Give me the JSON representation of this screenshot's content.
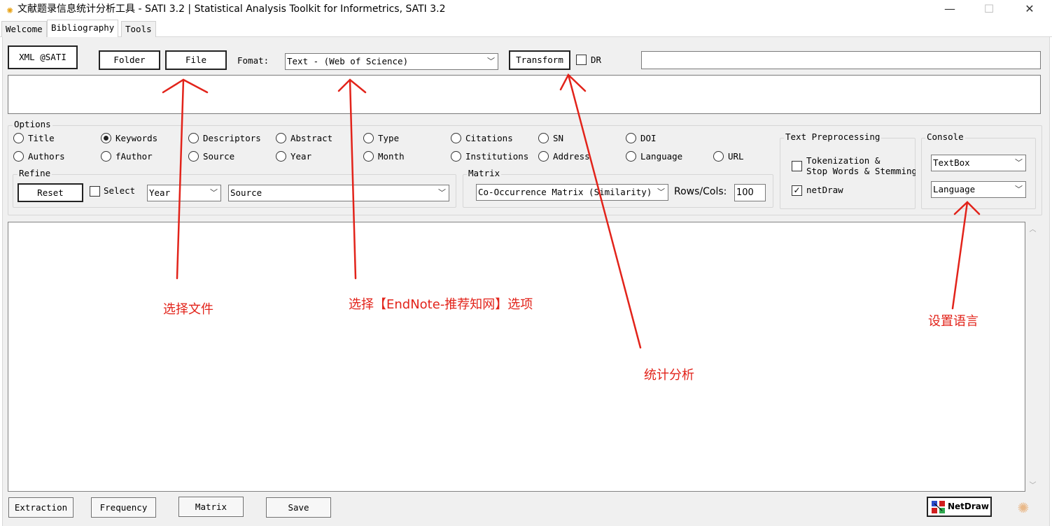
{
  "window": {
    "title": "文献题录信息统计分析工具 - SATI 3.2 | Statistical Analysis Toolkit for Informetrics, SATI 3.2",
    "icon": "sun-logo-icon",
    "minimize_glyph": "—",
    "maximize_glyph": "☐",
    "close_glyph": "✕"
  },
  "tabs": [
    {
      "label": "Welcome",
      "active": false
    },
    {
      "label": "Bibliography",
      "active": true
    },
    {
      "label": "Tools",
      "active": false
    }
  ],
  "toolbar": {
    "xml_label": "XML @SATI",
    "folder_label": "Folder",
    "file_label": "File",
    "format_label": "Fomat:",
    "format_value": "Text - (Web of Science)",
    "transform_label": "Transform",
    "dr_label": "DR",
    "dr_checked": false,
    "path_value": ""
  },
  "options": {
    "title": "Options",
    "row1": [
      {
        "label": "Title",
        "checked": false
      },
      {
        "label": "Keywords",
        "checked": true
      },
      {
        "label": "Descriptors",
        "checked": false
      },
      {
        "label": "Abstract",
        "checked": false
      },
      {
        "label": "Type",
        "checked": false
      },
      {
        "label": "Citations",
        "checked": false
      },
      {
        "label": "SN",
        "checked": false
      },
      {
        "label": "DOI",
        "checked": false
      }
    ],
    "row2": [
      {
        "label": "Authors",
        "checked": false
      },
      {
        "label": "fAuthor",
        "checked": false
      },
      {
        "label": "Source",
        "checked": false
      },
      {
        "label": "Year",
        "checked": false
      },
      {
        "label": "Month",
        "checked": false
      },
      {
        "label": "Institutions",
        "checked": false
      },
      {
        "label": "Address",
        "checked": false
      },
      {
        "label": "Language",
        "checked": false
      },
      {
        "label": "URL",
        "checked": false
      }
    ]
  },
  "refine": {
    "title": "Refine",
    "reset_label": "Reset",
    "select_label": "Select",
    "select_checked": false,
    "year_value": "Year",
    "source_value": "Source"
  },
  "matrix": {
    "title": "Matrix",
    "type_value": "Co-Occurrence Matrix (Similarity)",
    "rows_cols_label": "Rows/Cols:",
    "rows_cols_value": "100"
  },
  "text_preprocessing": {
    "title": "Text Preprocessing",
    "tokenization_line1": "Tokenization &",
    "tokenization_line2": "Stop Words & Stemming",
    "tokenization_checked": false,
    "netdraw_label": "netDraw",
    "netdraw_checked": true
  },
  "console": {
    "title": "Console",
    "output_value": "TextBox",
    "language_value": "Language"
  },
  "bottom_buttons": {
    "extraction": "Extraction",
    "frequency": "Frequency",
    "matrix": "Matrix",
    "save": "Save",
    "netdraw": "NetDraw"
  },
  "annotations": {
    "choose_file": "选择文件",
    "choose_endnote": "选择【EndNote-推荐知网】选项",
    "statistics": "统计分析",
    "set_language": "设置语言",
    "color": "#e2231a"
  }
}
